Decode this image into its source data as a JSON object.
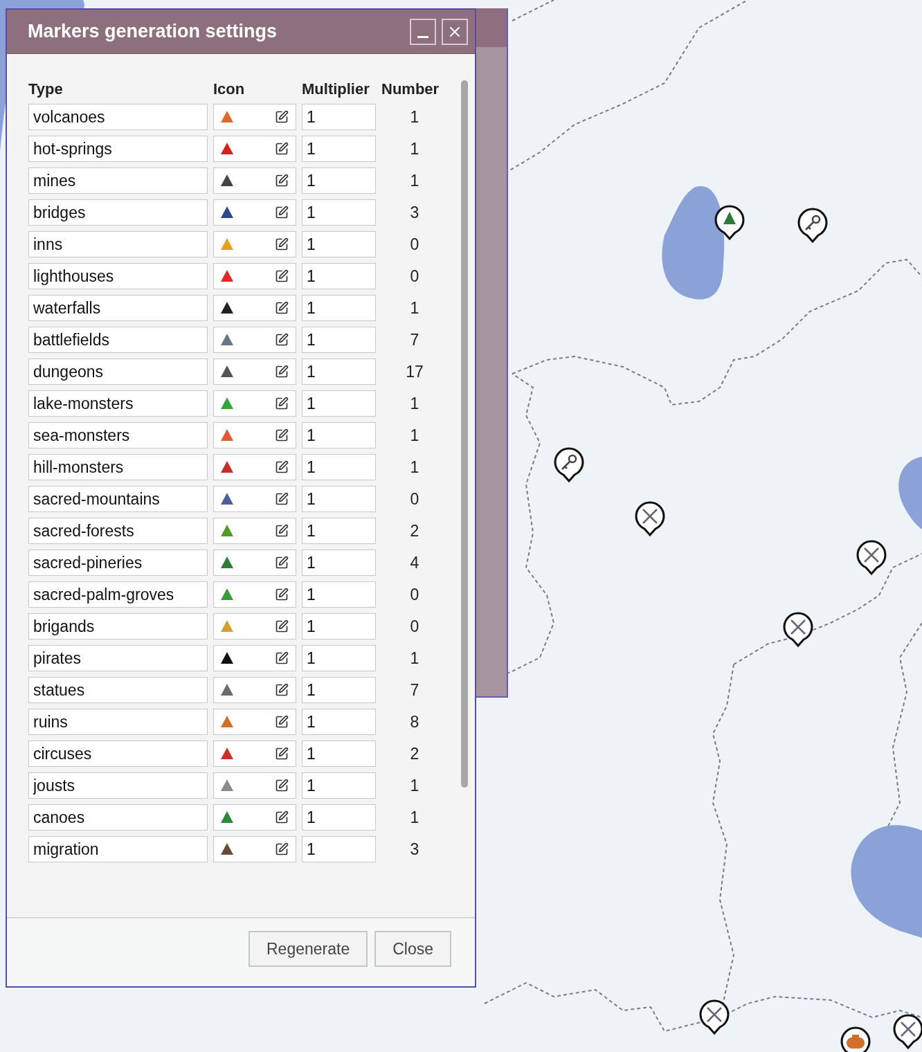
{
  "dialog": {
    "title": "Markers generation settings",
    "columns": [
      "Type",
      "Icon",
      "Multiplier",
      "Number"
    ],
    "rows": [
      {
        "type": "volcanoes",
        "color": "#e06a2a",
        "multiplier": "1",
        "number": "1"
      },
      {
        "type": "hot-springs",
        "color": "#d61f1f",
        "multiplier": "1",
        "number": "1"
      },
      {
        "type": "mines",
        "color": "#444444",
        "multiplier": "1",
        "number": "1"
      },
      {
        "type": "bridges",
        "color": "#2b4a8a",
        "multiplier": "1",
        "number": "3"
      },
      {
        "type": "inns",
        "color": "#e0a020",
        "multiplier": "1",
        "number": "0"
      },
      {
        "type": "lighthouses",
        "color": "#e02a2a",
        "multiplier": "1",
        "number": "0"
      },
      {
        "type": "waterfalls",
        "color": "#222222",
        "multiplier": "1",
        "number": "1"
      },
      {
        "type": "battlefields",
        "color": "#667788",
        "multiplier": "1",
        "number": "7"
      },
      {
        "type": "dungeons",
        "color": "#555555",
        "multiplier": "1",
        "number": "17"
      },
      {
        "type": "lake-monsters",
        "color": "#3aa13a",
        "multiplier": "1",
        "number": "1"
      },
      {
        "type": "sea-monsters",
        "color": "#e05a3a",
        "multiplier": "1",
        "number": "1"
      },
      {
        "type": "hill-monsters",
        "color": "#c0302a",
        "multiplier": "1",
        "number": "1"
      },
      {
        "type": "sacred-mountains",
        "color": "#4a5f9a",
        "multiplier": "1",
        "number": "0"
      },
      {
        "type": "sacred-forests",
        "color": "#4e9a2a",
        "multiplier": "1",
        "number": "2"
      },
      {
        "type": "sacred-pineries",
        "color": "#2e7a3a",
        "multiplier": "1",
        "number": "4"
      },
      {
        "type": "sacred-palm-groves",
        "color": "#3a9a3a",
        "multiplier": "1",
        "number": "0"
      },
      {
        "type": "brigands",
        "color": "#d4a030",
        "multiplier": "1",
        "number": "0"
      },
      {
        "type": "pirates",
        "color": "#111111",
        "multiplier": "1",
        "number": "1"
      },
      {
        "type": "statues",
        "color": "#6b6b6b",
        "multiplier": "1",
        "number": "7"
      },
      {
        "type": "ruins",
        "color": "#d0702a",
        "multiplier": "1",
        "number": "8"
      },
      {
        "type": "circuses",
        "color": "#d0302a",
        "multiplier": "1",
        "number": "2"
      },
      {
        "type": "jousts",
        "color": "#8a8a8a",
        "multiplier": "1",
        "number": "1"
      },
      {
        "type": "canoes",
        "color": "#2a8a3a",
        "multiplier": "1",
        "number": "1"
      },
      {
        "type": "migration",
        "color": "#6a4a3a",
        "multiplier": "1",
        "number": "3"
      }
    ],
    "buttons": [
      "Regenerate",
      "Close"
    ]
  }
}
